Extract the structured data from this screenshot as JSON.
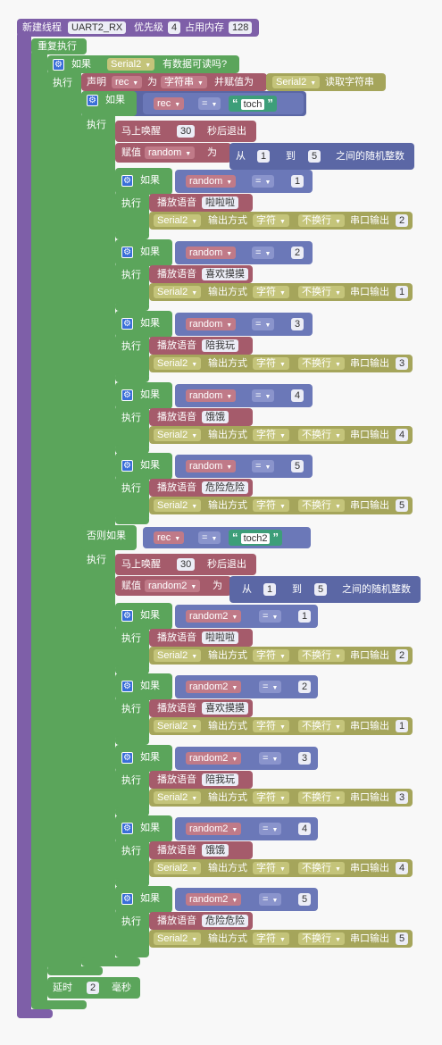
{
  "thread": {
    "title": "新建线程",
    "name": "UART2_RX",
    "priority_label": "优先级",
    "priority": "4",
    "memory_label": "占用内存",
    "memory": "128"
  },
  "loop": {
    "label": "重复执行"
  },
  "if_available": {
    "if_label": "如果",
    "serial": "Serial2",
    "cond": "有数据可读吗?",
    "do_label": "执行"
  },
  "declare": {
    "declare_label": "声明",
    "var": "rec",
    "as_label": "为",
    "type": "字符串",
    "assign_label": "并赋值为",
    "serial": "Serial2",
    "read": "读取字符串"
  },
  "if_toch": {
    "if_label": "如果",
    "var": "rec",
    "op": "=",
    "str": "toch",
    "do_label": "执行"
  },
  "elseif_toch2": {
    "label": "否则如果",
    "var": "rec",
    "op": "=",
    "str": "toch2",
    "do_label": "执行"
  },
  "group1": {
    "wake": {
      "label": "马上唤醒",
      "value": "30",
      "suffix": "秒后退出"
    },
    "assign": {
      "label": "赋值",
      "var": "random",
      "as_label": "为",
      "from": "从",
      "min": "1",
      "to": "到",
      "max": "5",
      "suffix": "之间的随机整数"
    },
    "ifs": [
      {
        "if_label": "如果",
        "var": "random",
        "op": "=",
        "num": "1",
        "do_label": "执行",
        "voice_label": "播放语音",
        "voice": "啦啦啦",
        "serial": "Serial2",
        "out_label": "输出方式",
        "fmt": "字符",
        "nl": "不换行",
        "sp_label": "串口输出",
        "sp_val": "2"
      },
      {
        "if_label": "如果",
        "var": "random",
        "op": "=",
        "num": "2",
        "do_label": "执行",
        "voice_label": "播放语音",
        "voice": "喜欢摸摸",
        "serial": "Serial2",
        "out_label": "输出方式",
        "fmt": "字符",
        "nl": "不换行",
        "sp_label": "串口输出",
        "sp_val": "1"
      },
      {
        "if_label": "如果",
        "var": "random",
        "op": "=",
        "num": "3",
        "do_label": "执行",
        "voice_label": "播放语音",
        "voice": "陪我玩",
        "serial": "Serial2",
        "out_label": "输出方式",
        "fmt": "字符",
        "nl": "不换行",
        "sp_label": "串口输出",
        "sp_val": "3"
      },
      {
        "if_label": "如果",
        "var": "random",
        "op": "=",
        "num": "4",
        "do_label": "执行",
        "voice_label": "播放语音",
        "voice": "饿饿",
        "serial": "Serial2",
        "out_label": "输出方式",
        "fmt": "字符",
        "nl": "不换行",
        "sp_label": "串口输出",
        "sp_val": "4"
      },
      {
        "if_label": "如果",
        "var": "random",
        "op": "=",
        "num": "5",
        "do_label": "执行",
        "voice_label": "播放语音",
        "voice": "危险危险",
        "serial": "Serial2",
        "out_label": "输出方式",
        "fmt": "字符",
        "nl": "不换行",
        "sp_label": "串口输出",
        "sp_val": "5"
      }
    ]
  },
  "group2": {
    "wake": {
      "label": "马上唤醒",
      "value": "30",
      "suffix": "秒后退出"
    },
    "assign": {
      "label": "赋值",
      "var": "random2",
      "as_label": "为",
      "from": "从",
      "min": "1",
      "to": "到",
      "max": "5",
      "suffix": "之间的随机整数"
    },
    "ifs": [
      {
        "if_label": "如果",
        "var": "random2",
        "op": "=",
        "num": "1",
        "do_label": "执行",
        "voice_label": "播放语音",
        "voice": "啦啦啦",
        "serial": "Serial2",
        "out_label": "输出方式",
        "fmt": "字符",
        "nl": "不换行",
        "sp_label": "串口输出",
        "sp_val": "2"
      },
      {
        "if_label": "如果",
        "var": "random2",
        "op": "=",
        "num": "2",
        "do_label": "执行",
        "voice_label": "播放语音",
        "voice": "喜欢摸摸",
        "serial": "Serial2",
        "out_label": "输出方式",
        "fmt": "字符",
        "nl": "不换行",
        "sp_label": "串口输出",
        "sp_val": "1"
      },
      {
        "if_label": "如果",
        "var": "random2",
        "op": "=",
        "num": "3",
        "do_label": "执行",
        "voice_label": "播放语音",
        "voice": "陪我玩",
        "serial": "Serial2",
        "out_label": "输出方式",
        "fmt": "字符",
        "nl": "不换行",
        "sp_label": "串口输出",
        "sp_val": "3"
      },
      {
        "if_label": "如果",
        "var": "random2",
        "op": "=",
        "num": "4",
        "do_label": "执行",
        "voice_label": "播放语音",
        "voice": "饿饿",
        "serial": "Serial2",
        "out_label": "输出方式",
        "fmt": "字符",
        "nl": "不换行",
        "sp_label": "串口输出",
        "sp_val": "4"
      },
      {
        "if_label": "如果",
        "var": "random2",
        "op": "=",
        "num": "5",
        "do_label": "执行",
        "voice_label": "播放语音",
        "voice": "危险危险",
        "serial": "Serial2",
        "out_label": "输出方式",
        "fmt": "字符",
        "nl": "不换行",
        "sp_label": "串口输出",
        "sp_val": "5"
      }
    ]
  },
  "delay": {
    "label": "延时",
    "value": "2",
    "unit": "毫秒"
  }
}
